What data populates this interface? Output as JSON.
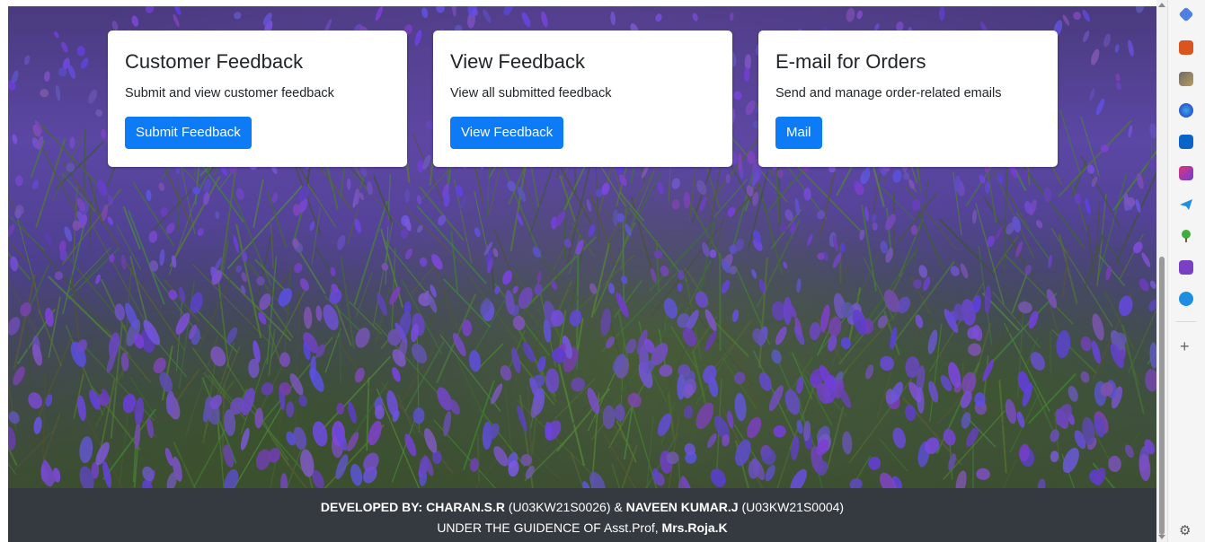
{
  "cards": [
    {
      "title": "Customer Feedback",
      "description": "Submit and view customer feedback",
      "button": "Submit Feedback"
    },
    {
      "title": "View Feedback",
      "description": "View all submitted feedback",
      "button": "View Feedback"
    },
    {
      "title": "E-mail for Orders",
      "description": "Send and manage order-related emails",
      "button": "Mail"
    }
  ],
  "footer": {
    "line1": {
      "prefix": "DEVELOPED BY: CHARAN.S.R",
      "id1": " (U03KW21S0026) & ",
      "name2": "NAVEEN KUMAR.J",
      "id2": " (U03KW21S0004)"
    },
    "line2": {
      "text": "UNDER THE GUIDENCE OF Asst.Prof, ",
      "name": "Mrs.Roja.K"
    }
  },
  "sidebar": {
    "icons": [
      "tag-icon",
      "toolbox-icon",
      "chess-icon",
      "copilot-icon",
      "outlook-icon",
      "designer-icon",
      "telegram-icon",
      "tree-icon",
      "onenote-icon",
      "skype-icon"
    ],
    "add_label": "+",
    "settings_icon": "gear-icon"
  },
  "colors": {
    "button_primary": "#0d7bf5",
    "footer_bg": "#343a40",
    "card_bg": "#ffffff"
  }
}
